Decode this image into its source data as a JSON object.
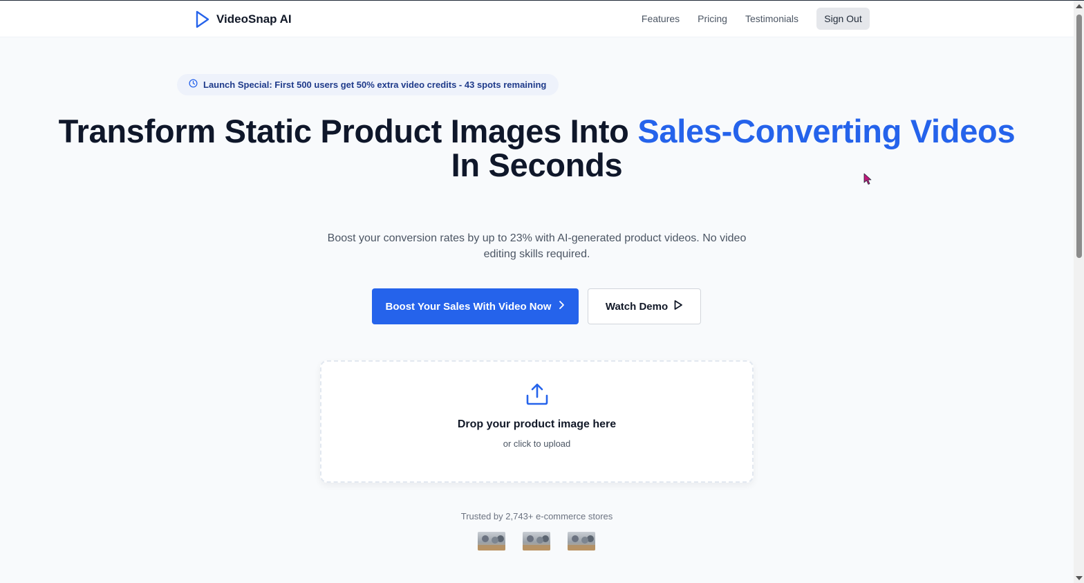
{
  "header": {
    "brand": "VideoSnap AI",
    "nav": [
      "Features",
      "Pricing",
      "Testimonials"
    ],
    "sign_out_label": "Sign Out"
  },
  "promo": {
    "text": "Launch Special: First 500 users get 50% extra video credits - 43 spots remaining"
  },
  "hero": {
    "title_part1": "Transform Static Product Images Into ",
    "title_accent": "Sales-Converting Videos",
    "title_part2": "In Seconds",
    "subtitle": "Boost your conversion rates by up to 23% with AI-generated product videos. No video editing skills required.",
    "primary_cta": "Boost Your Sales With Video Now",
    "secondary_cta": "Watch Demo"
  },
  "upload": {
    "title": "Drop your product image here",
    "subtitle": "or click to upload"
  },
  "trusted": {
    "text": "Trusted by 2,743+ e-commerce stores"
  },
  "colors": {
    "accent": "#2563eb",
    "background": "#f8fafc",
    "text": "#0f172a"
  },
  "icons": [
    "play-icon",
    "clock-icon",
    "chevron-right-icon",
    "play-outline-icon",
    "upload-icon"
  ]
}
